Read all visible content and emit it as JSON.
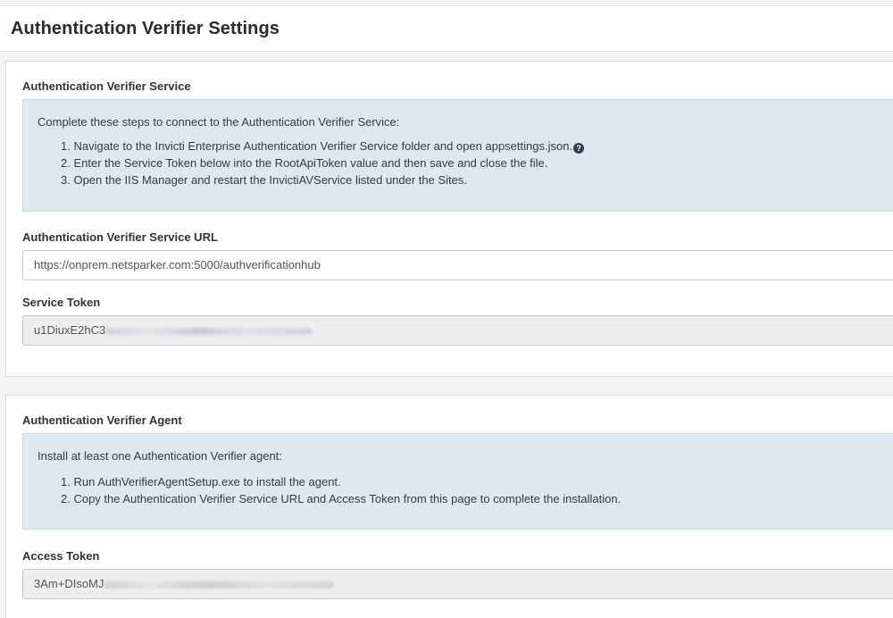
{
  "page": {
    "title": "Authentication Verifier Settings"
  },
  "service_section": {
    "title": "Authentication Verifier Service",
    "intro": "Complete these steps to connect to the Authentication Verifier Service:",
    "steps": [
      "1. Navigate to the Invicti Enterprise Authentication Verifier Service folder and open appsettings.json.",
      "2. Enter the Service Token below into the RootApiToken value and then save and close the file.",
      "3. Open the IIS Manager and restart the InvictiAVService listed under the Sites."
    ],
    "help_icon": "question-circle-icon",
    "url_label": "Authentication Verifier Service URL",
    "url_value": "https://onprem.netsparker.com:5000/authverificationhub",
    "token_label": "Service Token",
    "token_value": "u1DiuxE2hC3"
  },
  "agent_section": {
    "title": "Authentication Verifier Agent",
    "intro": "Install at least one Authentication Verifier agent:",
    "steps": [
      "1. Run AuthVerifierAgentSetup.exe to install the agent.",
      "2. Copy the Authentication Verifier Service URL and Access Token from this page to complete the installation."
    ],
    "token_label": "Access Token",
    "token_value": "3Am+DIsoMJ"
  },
  "colors": {
    "info_background": "#dde8f0",
    "readonly_background": "#eeeeee",
    "help_icon": "#2f4256"
  }
}
